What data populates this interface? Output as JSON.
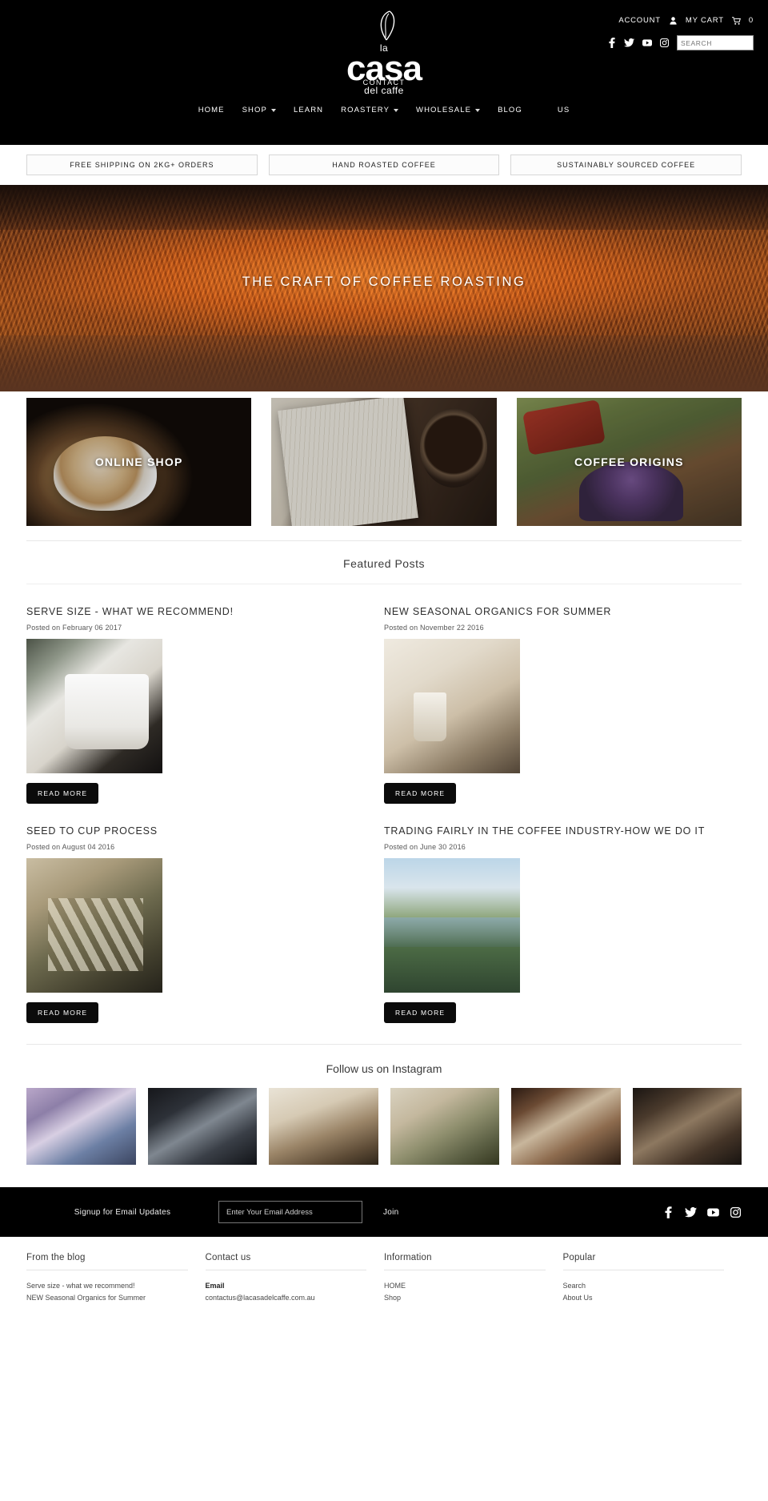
{
  "header": {
    "logo": {
      "top": "la",
      "main": "casa",
      "sub": "del caffe"
    },
    "account_label": "ACCOUNT",
    "cart_label": "MY CART",
    "cart_count": "0",
    "search_placeholder": "SEARCH",
    "search_value": "",
    "contact_label": "CONTACT",
    "social": [
      "facebook-icon",
      "twitter-icon",
      "youtube-icon",
      "instagram-icon"
    ],
    "nav": [
      {
        "label": "HOME",
        "caret": false
      },
      {
        "label": "SHOP",
        "caret": true
      },
      {
        "label": "LEARN",
        "caret": false
      },
      {
        "label": "ROASTERY",
        "caret": true
      },
      {
        "label": "WHOLESALE",
        "caret": true
      },
      {
        "label": "BLOG",
        "caret": false
      },
      {
        "label": "US",
        "caret": false
      }
    ]
  },
  "promos": [
    "FREE SHIPPING ON 2KG+ ORDERS",
    "HAND ROASTED COFFEE",
    "SUSTAINABLY SOURCED COFFEE"
  ],
  "hero": {
    "title": "THE CRAFT OF COFFEE ROASTING"
  },
  "tiles": [
    {
      "label": "ONLINE SHOP"
    },
    {
      "label": ""
    },
    {
      "label": "COFFEE ORIGINS"
    }
  ],
  "featured": {
    "heading": "Featured Posts",
    "read_more_label": "READ MORE",
    "posts": [
      {
        "title": "SERVE SIZE - WHAT WE RECOMMEND!",
        "date": "Posted on February 06 2017"
      },
      {
        "title": "NEW SEASONAL ORGANICS FOR SUMMER",
        "date": "Posted on November 22 2016"
      },
      {
        "title": "SEED TO CUP PROCESS",
        "date": "Posted on August 04 2016"
      },
      {
        "title": "TRADING FAIRLY IN THE COFFEE INDUSTRY-HOW WE DO IT",
        "date": "Posted on June 30 2016"
      }
    ]
  },
  "instagram": {
    "heading": "Follow us on Instagram",
    "items": [
      "post-1",
      "post-2",
      "post-3",
      "post-4",
      "post-5",
      "post-6"
    ]
  },
  "newsletter": {
    "label": "Signup for Email Updates",
    "placeholder": "Enter Your Email Address",
    "value": "",
    "join_label": "Join",
    "social": [
      "facebook-icon",
      "twitter-icon",
      "youtube-icon",
      "instagram-icon"
    ]
  },
  "footer": {
    "columns": [
      {
        "title": "From the blog",
        "items": [
          {
            "text": "Serve size - what we recommend!",
            "bold": false
          },
          {
            "text": "NEW Seasonal Organics for Summer",
            "bold": false
          }
        ]
      },
      {
        "title": "Contact us",
        "items": [
          {
            "text": "Email",
            "bold": true
          },
          {
            "text": "contactus@lacasadelcaffe.com.au",
            "bold": false
          }
        ]
      },
      {
        "title": "Information",
        "items": [
          {
            "text": "HOME",
            "bold": false
          },
          {
            "text": "Shop",
            "bold": false
          }
        ]
      },
      {
        "title": "Popular",
        "items": [
          {
            "text": "Search",
            "bold": false
          },
          {
            "text": "About Us",
            "bold": false
          }
        ]
      }
    ]
  }
}
